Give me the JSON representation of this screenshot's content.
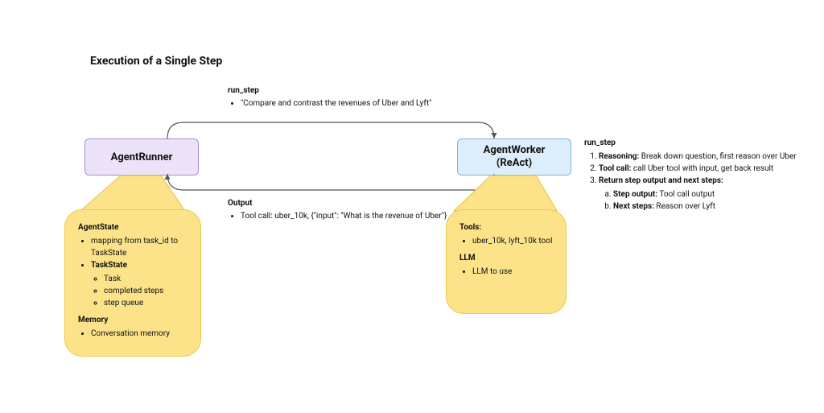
{
  "title": "Execution of a Single Step",
  "top_label": {
    "heading": "run_step",
    "bullet": "\"Compare and contrast the revenues of Uber and Lyft\""
  },
  "bottom_label": {
    "heading": "Output",
    "bullet": "Tool call: uber_10k, {\"input\": \"What is the revenue of Uber\"}"
  },
  "nodes": {
    "runner": "AgentRunner",
    "worker_line1": "AgentWorker",
    "worker_line2": "(ReAct)"
  },
  "runner_blob": {
    "h1": "AgentState",
    "i1": "mapping from task_id to TaskState",
    "h2": "TaskState",
    "i2a": "Task",
    "i2b": "completed steps",
    "i2c": "step queue",
    "h3": "Memory",
    "i3": "Conversation memory"
  },
  "worker_blob": {
    "h1": "Tools:",
    "i1": "uber_10k, lyft_10k tool",
    "h2": "LLM",
    "i2": "LLM to use"
  },
  "annotation": {
    "heading": "run_step",
    "l1b": "Reasoning:",
    "l1t": " Break down question, first reason over Uber",
    "l2b": "Tool call:",
    "l2t": " call Uber tool with input, get back result",
    "l3b": "Return step output and next steps:",
    "l3a_b": "Step output:",
    "l3a_t": " Tool call output",
    "l3b_b": "Next steps:",
    "l3b_t": " Reason over Lyft"
  }
}
